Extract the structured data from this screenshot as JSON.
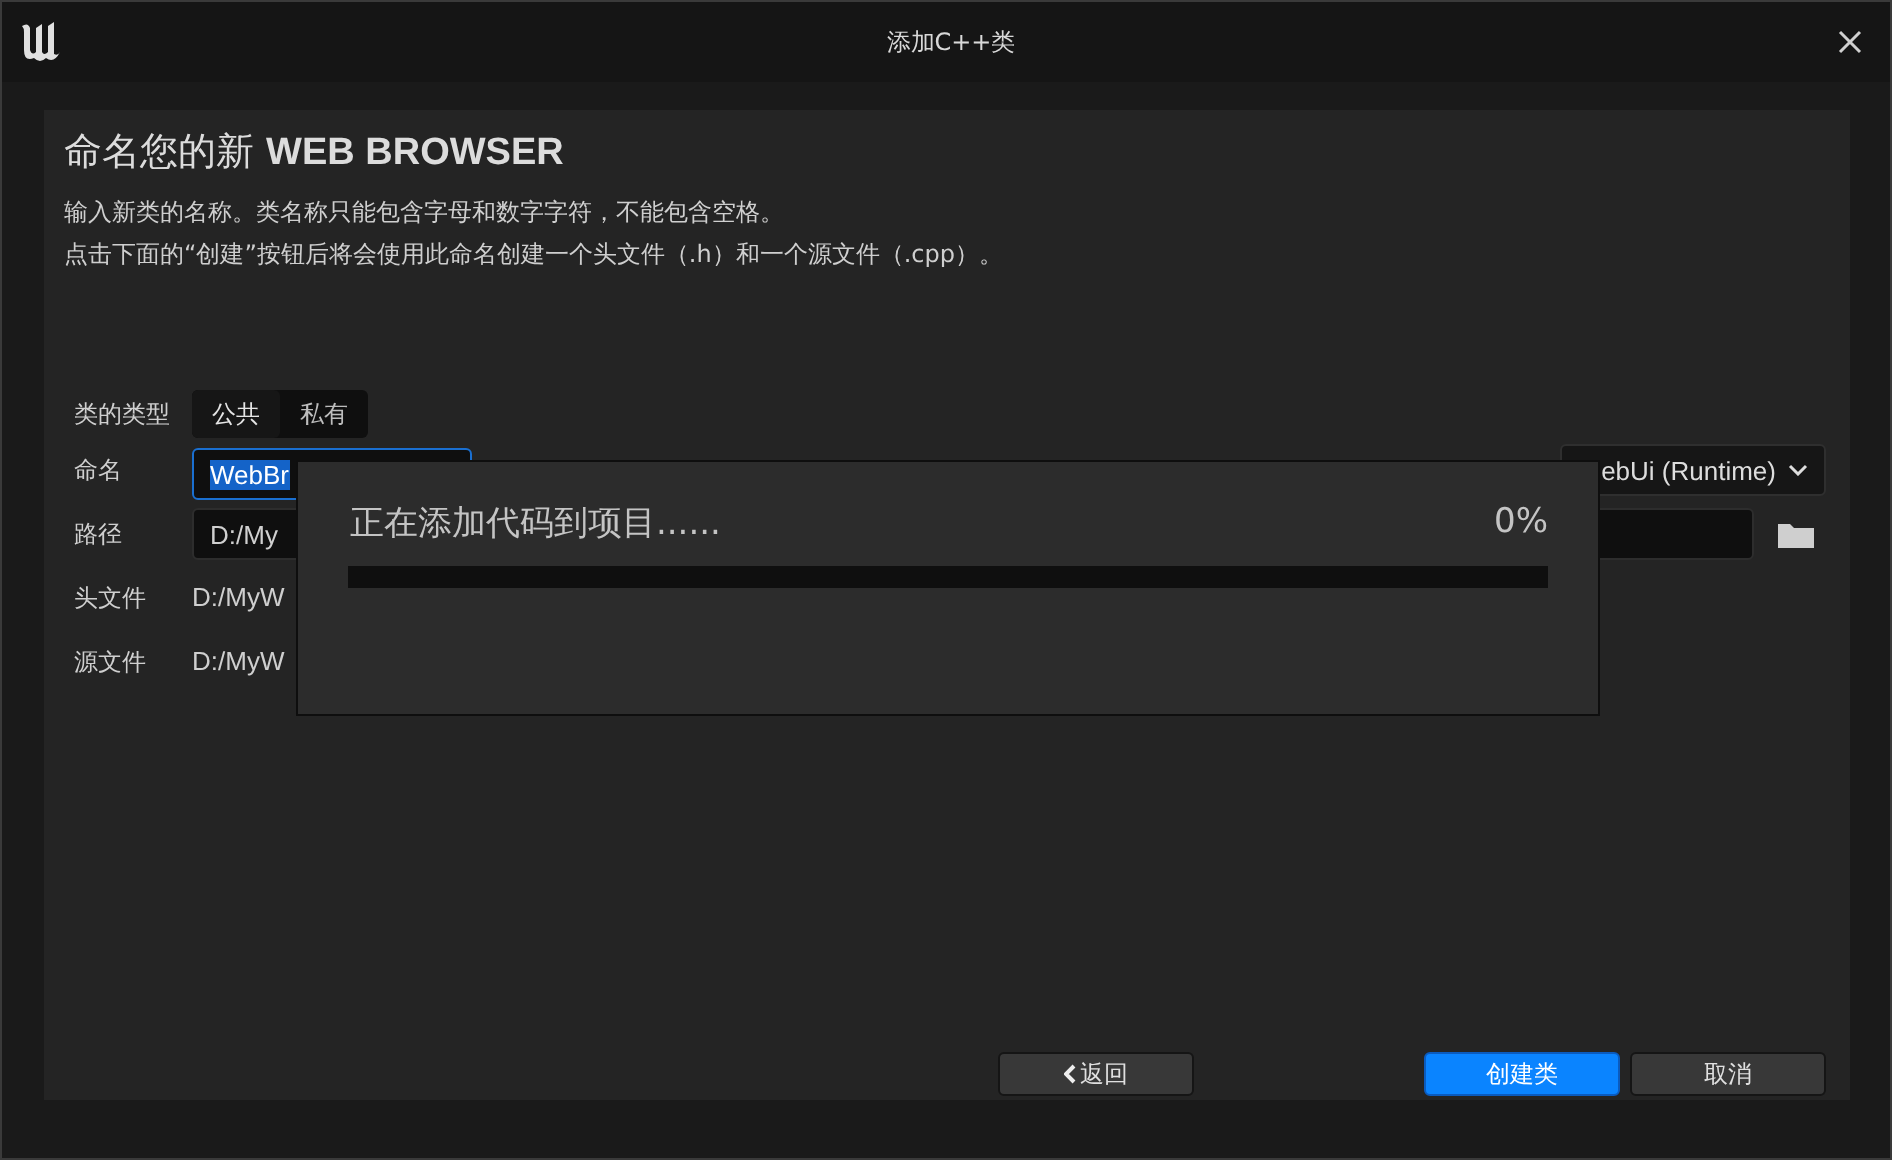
{
  "window": {
    "title": "添加C++类"
  },
  "heading": "命名您的新 **WEB BROWSER**",
  "description": [
    "输入新类的名称。类名称只能包含字母和数字字符，不能包含空格。",
    "点击下面的“创建”按钮后将会使用此命名创建一个头文件（.h）和一个源文件（.cpp）。"
  ],
  "class_type": {
    "label": "类的类型",
    "options": [
      {
        "label": "公共",
        "selected": true
      },
      {
        "label": "私有",
        "selected": false
      }
    ]
  },
  "name": {
    "label": "命名",
    "value": "WebBr",
    "module": "ebUi (Runtime)"
  },
  "path": {
    "label": "路径",
    "value": "D:/My"
  },
  "header_file": {
    "label": "头文件",
    "value": "D:/MyW"
  },
  "source_file": {
    "label": "源文件",
    "value": "D:/MyW"
  },
  "progress": {
    "message": "正在添加代码到项目......",
    "percent": "0%",
    "level": 0
  },
  "buttons": [
    {
      "label": "返回",
      "kind": "back"
    },
    {
      "label": "创建类",
      "kind": "primary"
    },
    {
      "label": "取消",
      "kind": "normal"
    }
  ]
}
